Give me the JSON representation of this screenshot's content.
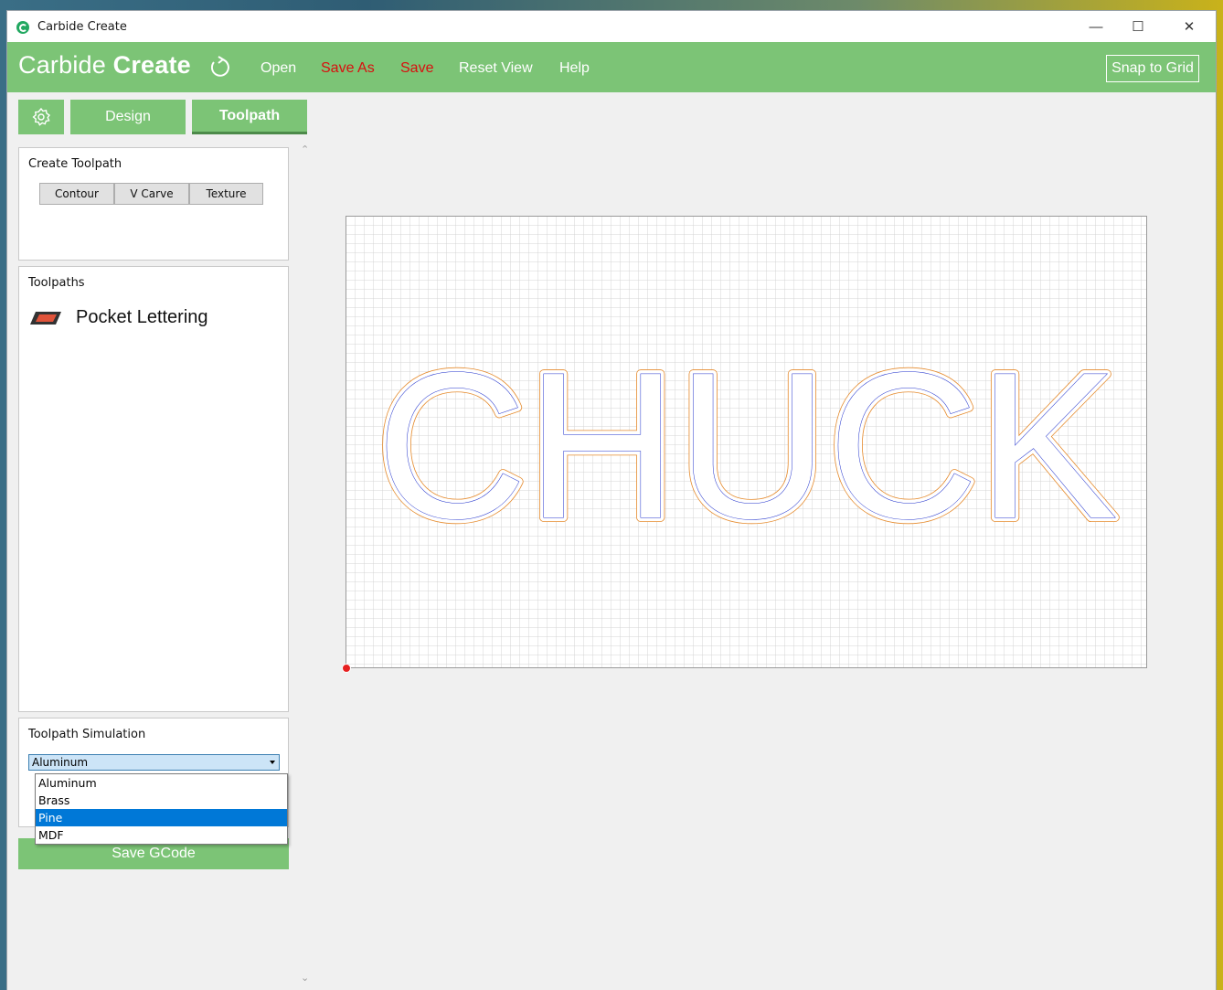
{
  "window": {
    "title": "Carbide Create"
  },
  "menubar": {
    "brand_light": "Carbide",
    "brand_bold": "Create",
    "items": [
      {
        "label": "Open",
        "color": "#ffffff"
      },
      {
        "label": "Save As",
        "color": "#d90f0f"
      },
      {
        "label": "Save",
        "color": "#d90f0f"
      },
      {
        "label": "Reset View",
        "color": "#ffffff"
      },
      {
        "label": "Help",
        "color": "#ffffff"
      }
    ],
    "snap_to_grid": "Snap to Grid"
  },
  "tabs": {
    "design": "Design",
    "toolpath": "Toolpath",
    "active": "Toolpath"
  },
  "create_toolpath": {
    "title": "Create Toolpath",
    "buttons": [
      "Contour",
      "V Carve",
      "Texture"
    ]
  },
  "toolpaths": {
    "title": "Toolpaths",
    "items": [
      {
        "label": "Pocket Lettering",
        "icon": "pocket-icon"
      }
    ]
  },
  "simulation": {
    "title": "Toolpath Simulation",
    "selected": "Aluminum",
    "options": [
      "Aluminum",
      "Brass",
      "Pine",
      "MDF"
    ],
    "highlighted": "Pine"
  },
  "save_gcode": "Save GCode",
  "canvas": {
    "text": "CHUCK",
    "colors": {
      "grid": "#d4d4d4",
      "outline": "#e58a2c",
      "toolpath": "#2233cc",
      "accent": "#7cc476"
    }
  }
}
